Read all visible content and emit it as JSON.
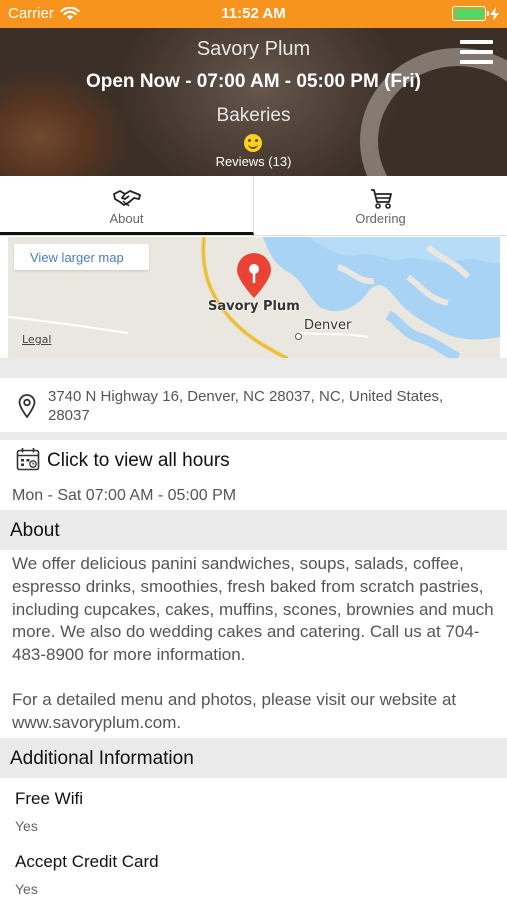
{
  "status_bar": {
    "carrier": "Carrier",
    "time": "11:52 AM"
  },
  "header": {
    "title": "Savory Plum",
    "hours": "Open Now - 07:00 AM - 05:00 PM (Fri)",
    "category": "Bakeries",
    "reviews": "Reviews (13)"
  },
  "tabs": [
    {
      "label": "About",
      "icon": "handshake-icon",
      "active": true
    },
    {
      "label": "Ordering",
      "icon": "cart-icon",
      "active": false
    }
  ],
  "map": {
    "view_larger": "View larger map",
    "place_label": "Savory Plum",
    "town_label": "Denver",
    "legal": "Legal"
  },
  "address": "3740 N Highway 16, Denver, NC 28037, NC, United States, 28037",
  "hours": {
    "link": "Click to view all hours",
    "line": "Mon - Sat 07:00 AM - 05:00 PM"
  },
  "about": {
    "heading": "About",
    "paragraph1": "We offer delicious panini sandwiches, soups, salads, coffee, espresso drinks, smoothies, fresh baked from scratch pastries, including cupcakes, cakes, muffins, scones, brownies and much more.  We also do wedding cakes and catering.  Call us at 704-483-8900 for more information.",
    "paragraph2": "For a detailed menu and photos, please visit our website at www.savoryplum.com."
  },
  "additional": {
    "heading": "Additional Information",
    "items": [
      {
        "title": "Free Wifi",
        "value": "Yes"
      },
      {
        "title": "Accept Credit Card",
        "value": "Yes"
      }
    ]
  },
  "colors": {
    "status_bar": "#f7941d",
    "pin": "#ea4335",
    "battery": "#4cd964"
  }
}
